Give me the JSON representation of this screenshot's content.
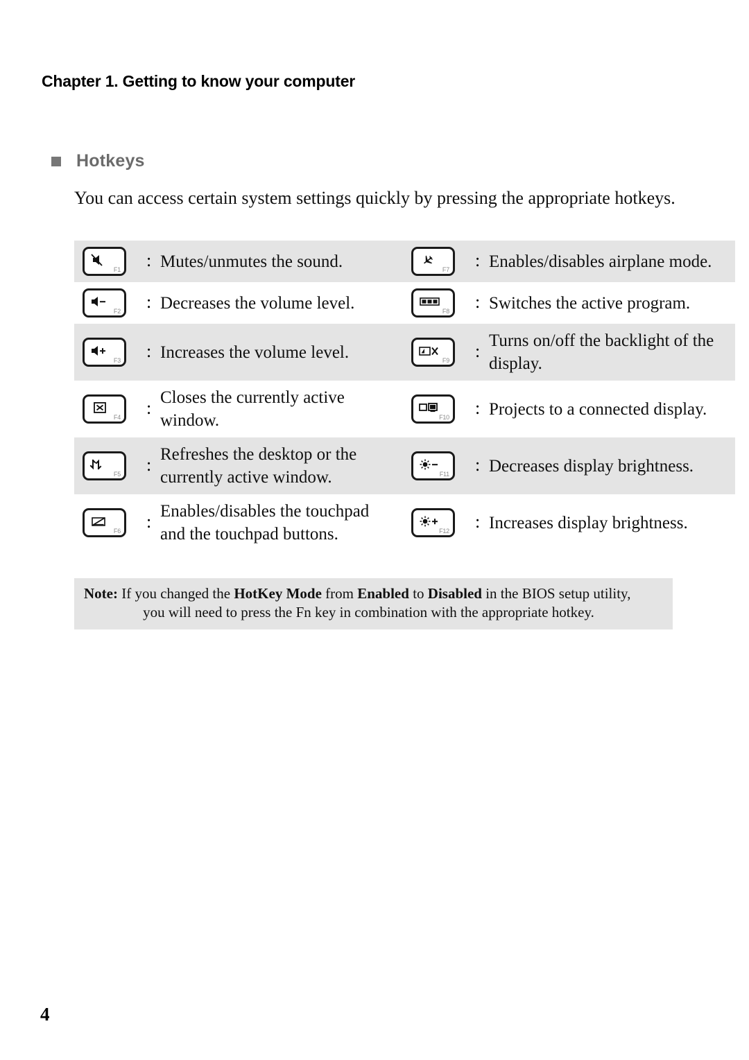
{
  "document": {
    "chapter_heading": "Chapter 1. Getting to know your computer",
    "page_number": "4"
  },
  "section": {
    "title": "Hotkeys",
    "bullet_color": "#777777",
    "title_color": "#6b6b6b",
    "intro": "You can access certain system settings quickly by pressing the appropriate hotkeys."
  },
  "table": {
    "separator": ":",
    "shade_color": "#e4e4e4",
    "rows": [
      {
        "shaded": true,
        "left": {
          "key": "F1",
          "icon": "speaker-mute-icon",
          "description": "Mutes/unmutes the sound."
        },
        "right": {
          "key": "F7",
          "icon": "airplane-icon",
          "description": "Enables/disables airplane mode."
        }
      },
      {
        "shaded": false,
        "left": {
          "key": "F2",
          "icon": "volume-down-icon",
          "description": "Decreases the volume level."
        },
        "right": {
          "key": "F8",
          "icon": "task-switcher-icon",
          "description": "Switches the active program."
        }
      },
      {
        "shaded": true,
        "left": {
          "key": "F3",
          "icon": "volume-up-icon",
          "description": "Increases the volume level."
        },
        "right": {
          "key": "F9",
          "icon": "display-backlight-off-icon",
          "description": "Turns on/off the backlight of the display."
        }
      },
      {
        "shaded": false,
        "left": {
          "key": "F4",
          "icon": "close-window-icon",
          "description": "Closes the currently active window."
        },
        "right": {
          "key": "F10",
          "icon": "project-display-icon",
          "description": "Projects to a connected display."
        }
      },
      {
        "shaded": true,
        "left": {
          "key": "F5",
          "icon": "refresh-icon",
          "description": "Refreshes the desktop or the currently active window."
        },
        "right": {
          "key": "F11",
          "icon": "brightness-down-icon",
          "description": "Decreases display brightness."
        }
      },
      {
        "shaded": false,
        "left": {
          "key": "F6",
          "icon": "touchpad-off-icon",
          "description": "Enables/disables the touchpad and the touchpad buttons."
        },
        "right": {
          "key": "F12",
          "icon": "brightness-up-icon",
          "description": "Increases display brightness."
        }
      }
    ]
  },
  "note": {
    "label": "Note:",
    "line1_part1": " If you changed the ",
    "line1_bold1": "HotKey Mode",
    "line1_part2": " from ",
    "line1_bold2": "Enabled",
    "line1_part3": " to ",
    "line1_bold3": "Disabled",
    "line1_part4": " in the BIOS setup utility,",
    "line2": "you will need to press the Fn key in combination with the appropriate hotkey."
  }
}
